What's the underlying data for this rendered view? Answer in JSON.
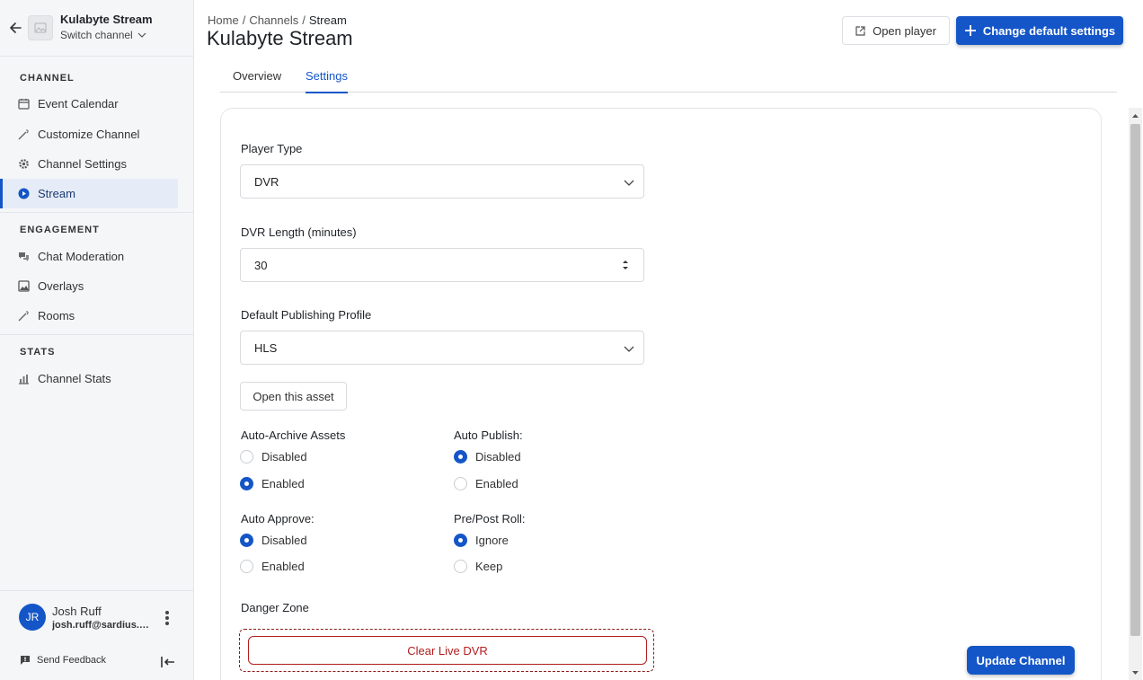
{
  "sidebar": {
    "channel_name": "Kulabyte Stream",
    "switch_label": "Switch channel",
    "sections": [
      {
        "title": "CHANNEL"
      },
      {
        "title": "ENGAGEMENT"
      },
      {
        "title": "STATS"
      }
    ],
    "items": [
      {
        "label": "Event Calendar",
        "icon": "calendar-icon"
      },
      {
        "label": "Customize Channel",
        "icon": "wand-icon"
      },
      {
        "label": "Channel Settings",
        "icon": "gear-icon"
      },
      {
        "label": "Stream",
        "icon": "play-circle-icon",
        "active": true
      },
      {
        "label": "Chat Moderation",
        "icon": "chat-icon"
      },
      {
        "label": "Overlays",
        "icon": "image-icon"
      },
      {
        "label": "Rooms",
        "icon": "wand-icon"
      },
      {
        "label": "Channel Stats",
        "icon": "bar-chart-icon"
      }
    ],
    "user": {
      "initials": "JR",
      "name": "Josh Ruff",
      "email": "josh.ruff@sardius.m..."
    },
    "feedback_label": "Send Feedback"
  },
  "header": {
    "breadcrumb": [
      "Home",
      "/",
      "Channels",
      "/",
      "Stream"
    ],
    "title": "Kulabyte Stream",
    "open_player_label": "Open player",
    "change_defaults_label": "Change default settings"
  },
  "tabs": [
    {
      "label": "Overview",
      "active": false
    },
    {
      "label": "Settings",
      "active": true
    }
  ],
  "form": {
    "player_type": {
      "label": "Player Type",
      "value": "DVR"
    },
    "dvr_length": {
      "label": "DVR Length (minutes)",
      "value": "30"
    },
    "publishing_profile": {
      "label": "Default Publishing Profile",
      "value": "HLS"
    },
    "open_asset_label": "Open this asset",
    "auto_archive": {
      "label": "Auto-Archive Assets",
      "options": [
        "Disabled",
        "Enabled"
      ],
      "selected": "Enabled"
    },
    "auto_publish": {
      "label": "Auto Publish:",
      "options": [
        "Disabled",
        "Enabled"
      ],
      "selected": "Disabled"
    },
    "auto_approve": {
      "label": "Auto Approve:",
      "options": [
        "Disabled",
        "Enabled"
      ],
      "selected": "Disabled"
    },
    "pre_post_roll": {
      "label": "Pre/Post Roll:",
      "options": [
        "Ignore",
        "Keep"
      ],
      "selected": "Ignore"
    },
    "danger_zone_label": "Danger Zone",
    "clear_dvr_label": "Clear Live DVR",
    "update_label": "Update Channel"
  },
  "colors": {
    "accent": "#1456c8",
    "danger": "#b21e1e",
    "sidebar_bg": "#f5f6f8"
  }
}
